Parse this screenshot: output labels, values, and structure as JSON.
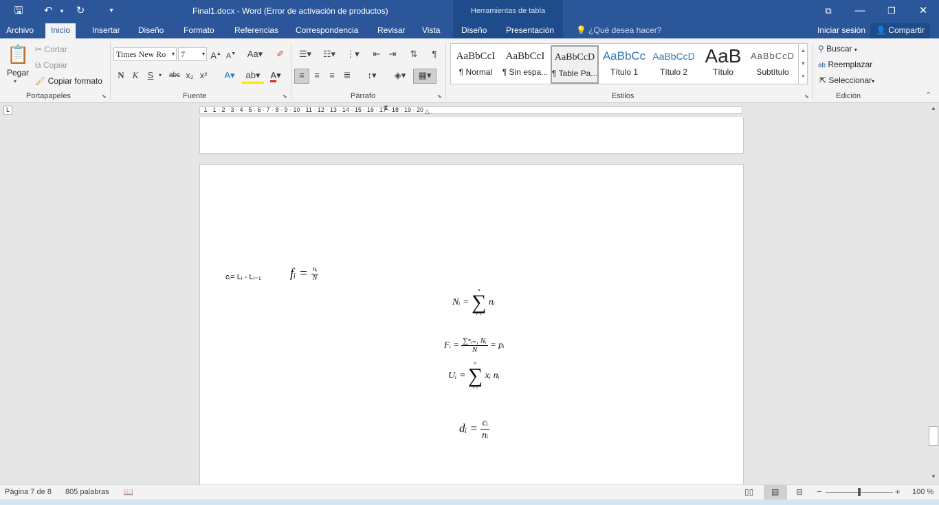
{
  "titlebar": {
    "title": "Final1.docx - Word (Error de activación de productos)",
    "context": "Herramientas de tabla"
  },
  "tabs": [
    "Archivo",
    "Inicio",
    "Insertar",
    "Diseño",
    "Formato",
    "Referencias",
    "Correspondencia",
    "Revisar",
    "Vista",
    "Diseño",
    "Presentación"
  ],
  "tell_me": "¿Qué desea hacer?",
  "signin": "Iniciar sesión",
  "share": "Compartir",
  "clipboard": {
    "paste": "Pegar",
    "cut": "Cortar",
    "copy": "Copiar",
    "format_painter": "Copiar formato",
    "label": "Portapapeles"
  },
  "font": {
    "name": "Times New Ro",
    "size": "7",
    "label": "Fuente",
    "bold": "N",
    "italic": "K",
    "underline": "S",
    "strike": "abc",
    "sub": "x₂",
    "sup": "x²"
  },
  "paragraph": {
    "label": "Párrafo"
  },
  "styles": {
    "label": "Estilos",
    "items": [
      {
        "preview": "AaBbCcI",
        "name": "¶ Normal"
      },
      {
        "preview": "AaBbCcI",
        "name": "¶ Sin espa..."
      },
      {
        "preview": "AaBbCcD",
        "name": "¶ Table Pa..."
      },
      {
        "preview": "AaBbCc",
        "name": "Título 1"
      },
      {
        "preview": "AaBbCcD",
        "name": "Título 2"
      },
      {
        "preview": "AaB",
        "name": "Título"
      },
      {
        "preview": "AaBbCcD",
        "name": "Subtítulo"
      }
    ]
  },
  "editing": {
    "label": "Edición",
    "find": "Buscar",
    "replace": "Reemplazar",
    "select": "Seleccionar"
  },
  "ruler": {
    "text": "· 1 · 1 · 2 · 3 · 4 · 5 · 6 · 7 · 8 · 9 · 10 · 11 · 12 · 13 · 14 · 15 · 16 · 17 · 18 · 19 · 20"
  },
  "document": {
    "ci": "cᵢ= Lᵢ - Lᵢ₋₁",
    "fi_lhs": "fᵢ =",
    "fi_num": "nᵢ",
    "fi_den": "N",
    "Ni_lhs": "Nᵢ =",
    "Ni_rhs": "nᵢ",
    "sum_top": "n",
    "sum_bot": "i=1",
    "Fi_lhs": "Fᵢ =",
    "Fi_num": "∑ⁿᵢ₌₁ Nᵢ",
    "Fi_den": "N",
    "Fi_rhs": "= pᵢ",
    "Ui_lhs": "Uᵢ =",
    "Ui_rhs": "xᵢ nᵢ",
    "di_lhs": "dᵢ =",
    "di_num": "cᵢ",
    "di_den": "nᵢ"
  },
  "status": {
    "page": "Página 7 de 8",
    "words": "805 palabras",
    "zoom": "100 %"
  }
}
